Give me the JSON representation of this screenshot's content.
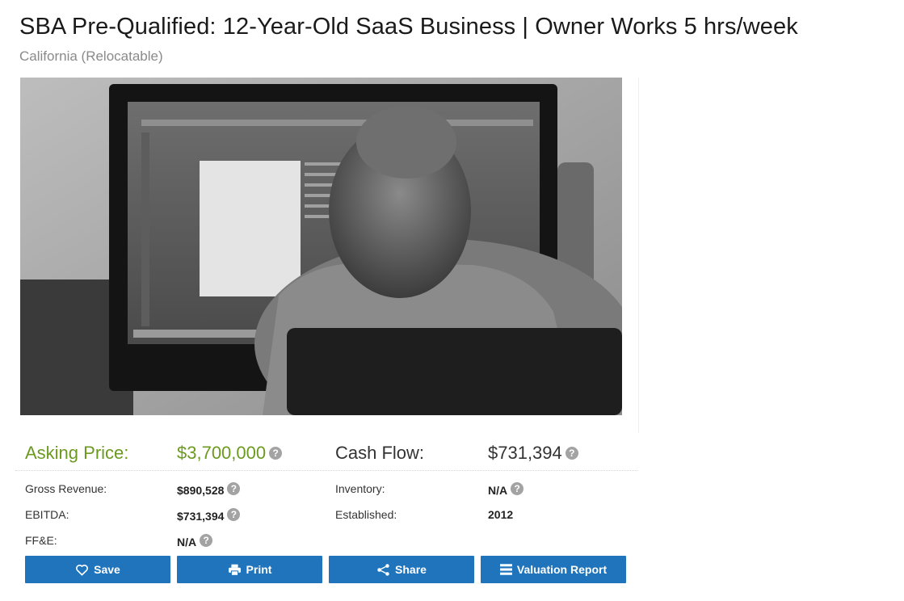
{
  "listing": {
    "title": "SBA Pre-Qualified: 12-Year-Old SaaS Business | Owner Works 5 hrs/week",
    "location": "California (Relocatable)"
  },
  "financials": {
    "asking_price_label": "Asking Price:",
    "asking_price_value": "$3,700,000",
    "cash_flow_label": "Cash Flow:",
    "cash_flow_value": "$731,394",
    "gross_revenue_label": "Gross Revenue:",
    "gross_revenue_value": "$890,528",
    "ebitda_label": "EBITDA:",
    "ebitda_value": "$731,394",
    "ffe_label": "FF&E:",
    "ffe_value": "N/A",
    "inventory_label": "Inventory:",
    "inventory_value": "N/A",
    "established_label": "Established:",
    "established_value": "2012",
    "help_glyph": "?"
  },
  "actions": {
    "save_label": "Save",
    "print_label": "Print",
    "share_label": "Share",
    "valuation_label": "Valuation Report"
  },
  "colors": {
    "price_green": "#6b9a1f",
    "button_blue": "#1f74bb",
    "help_grey": "#a3a3a3"
  },
  "icons": [
    "heart-icon",
    "printer-icon",
    "share-icon",
    "list-icon",
    "help-icon"
  ]
}
